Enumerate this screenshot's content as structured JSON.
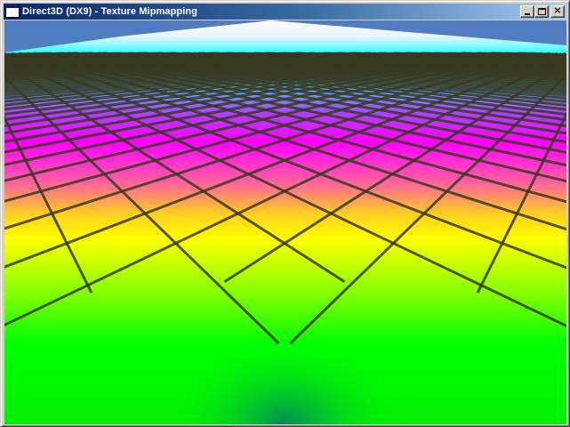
{
  "window": {
    "title": "Direct3D (DX9) - Texture Mipmapping",
    "controls": {
      "minimize_icon": "minimize-icon",
      "maximize_icon": "maximize-icon",
      "close_icon": "close-icon"
    }
  },
  "scene": {
    "description_icon": "textured-plane",
    "colors": {
      "sky": "#5a86c8",
      "far": "#ffffff",
      "cyan": "#00ffff",
      "magenta": "#ff00ff",
      "yellow": "#ffff00",
      "green": "#00ff00",
      "grid_line": "#3a3a22"
    }
  }
}
